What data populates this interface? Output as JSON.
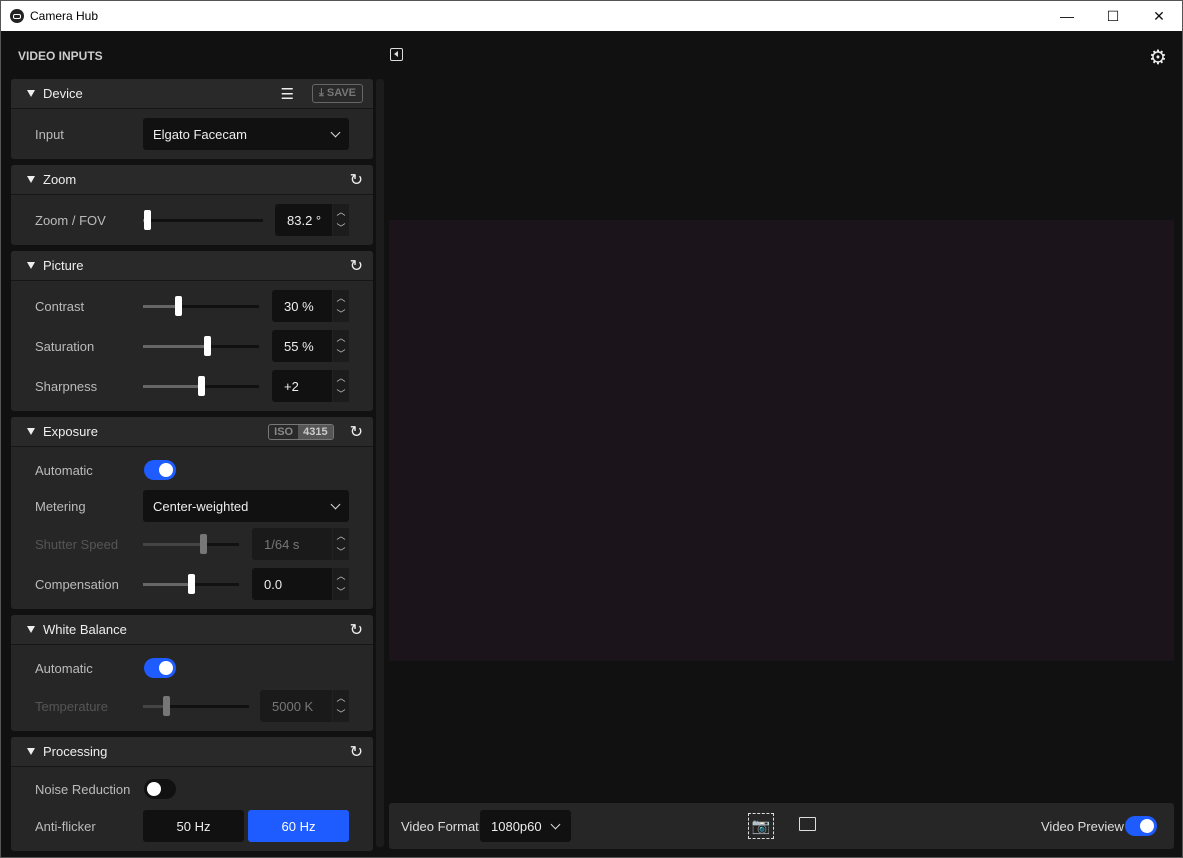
{
  "window": {
    "title": "Camera Hub",
    "min": "—",
    "max": "☐",
    "close": "✕"
  },
  "sidebar_title": "VIDEO INPUTS",
  "sections": {
    "device": {
      "title": "Device",
      "save": "⤓ SAVE",
      "input_label": "Input",
      "input_value": "Elgato Facecam"
    },
    "zoom": {
      "title": "Zoom",
      "label": "Zoom / FOV",
      "value": "83.2 °",
      "level": 0.03
    },
    "picture": {
      "title": "Picture",
      "contrast": {
        "label": "Contrast",
        "value": "30 %",
        "level": 0.3
      },
      "saturation": {
        "label": "Saturation",
        "value": "55 %",
        "level": 0.55
      },
      "sharpness": {
        "label": "Sharpness",
        "value": "+2",
        "level": 0.5
      }
    },
    "exposure": {
      "title": "Exposure",
      "iso_label": "ISO",
      "iso_value": "4315",
      "automatic": {
        "label": "Automatic",
        "on": true
      },
      "metering": {
        "label": "Metering",
        "value": "Center-weighted"
      },
      "shutter": {
        "label": "Shutter Speed",
        "value": "1/64 s",
        "level": 0.63
      },
      "compensation": {
        "label": "Compensation",
        "value": "0.0",
        "level": 0.5
      }
    },
    "white_balance": {
      "title": "White Balance",
      "automatic": {
        "label": "Automatic",
        "on": true
      },
      "temperature": {
        "label": "Temperature",
        "value": "5000 K",
        "level": 0.22
      }
    },
    "processing": {
      "title": "Processing",
      "noise": {
        "label": "Noise Reduction",
        "on": false
      },
      "antiflicker": {
        "label": "Anti-flicker",
        "options": [
          "50 Hz",
          "60 Hz"
        ],
        "selected": "60 Hz"
      }
    }
  },
  "bottom": {
    "format_label": "Video Format",
    "format_value": "1080p60",
    "preview_label": "Video Preview",
    "preview_on": true
  },
  "colors": {
    "accent": "#1e5cff"
  }
}
